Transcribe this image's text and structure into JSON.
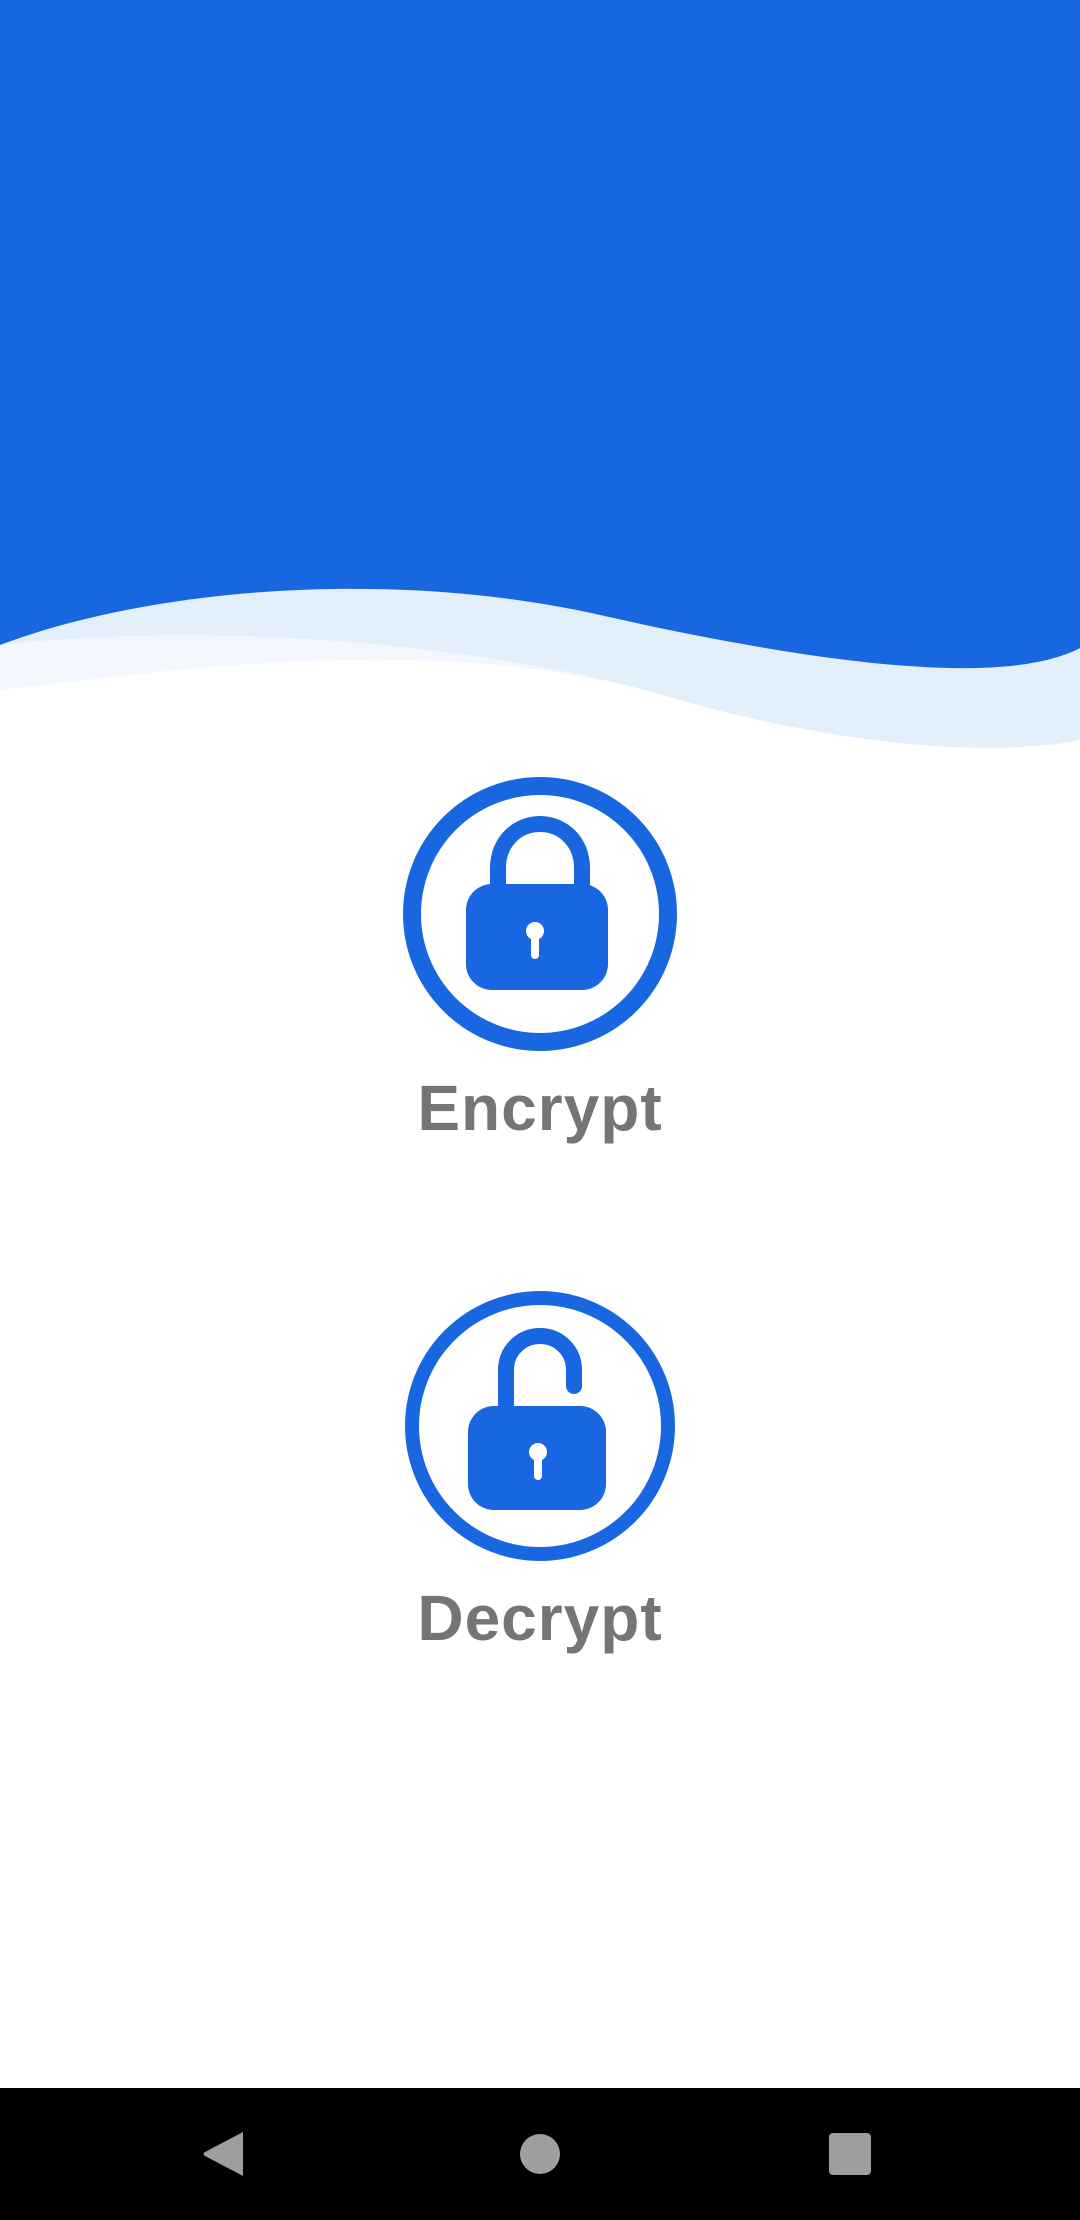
{
  "colors": {
    "primary_blue": "#1867E0",
    "wave_light": "#E3F0FC",
    "wave_lighter": "#F3F8FE",
    "label_gray": "#757575",
    "nav_bar": "#000000",
    "nav_icon": "#9E9E9E"
  },
  "actions": {
    "encrypt": {
      "icon": "lock-closed-icon",
      "label": "Encrypt"
    },
    "decrypt": {
      "icon": "lock-open-icon",
      "label": "Decrypt"
    }
  },
  "navigation": {
    "back_icon": "back-triangle-icon",
    "home_icon": "home-circle-icon",
    "recents_icon": "recents-square-icon"
  }
}
